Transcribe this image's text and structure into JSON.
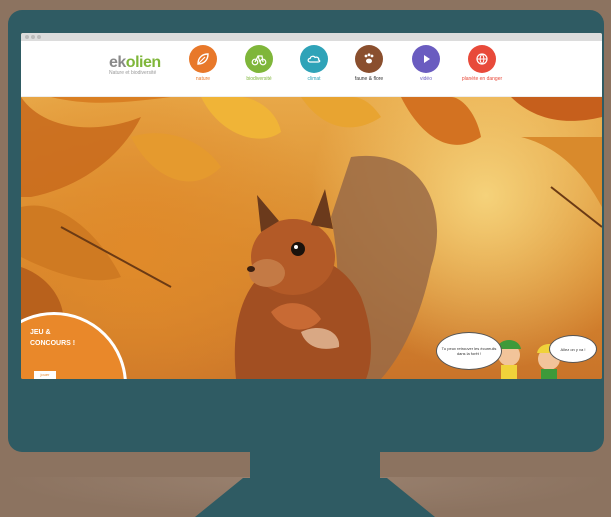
{
  "site": {
    "logo_part1": "ek",
    "logo_part2": "olien",
    "logo_tagline": "Nature et biodiversité"
  },
  "nav": {
    "items": [
      {
        "label": "nature",
        "color": "#e8782a",
        "icon": "leaf-icon"
      },
      {
        "label": "biodiversité",
        "color": "#7fb63a",
        "icon": "bicycle-icon"
      },
      {
        "label": "climat",
        "color": "#2fa3b8",
        "icon": "cloud-icon"
      },
      {
        "label": "faune & flore",
        "color": "#8a4f2e",
        "icon": "pawprint-icon"
      },
      {
        "label": "vidéo",
        "color": "#6a5cc0",
        "icon": "play-icon"
      },
      {
        "label": "planète en danger",
        "color": "#e84a3a",
        "icon": "globe-icon"
      }
    ]
  },
  "hero": {
    "cta_line1": "JEU &",
    "cta_line2": "CONCOURS !",
    "cta_button": "jouer",
    "bubble_left": "Tu peux retrouver les écureuils dans la forêt !",
    "bubble_right": "Allez on y va !"
  },
  "colors": {
    "monitor": "#2f5b63",
    "background": "#8c7360"
  }
}
